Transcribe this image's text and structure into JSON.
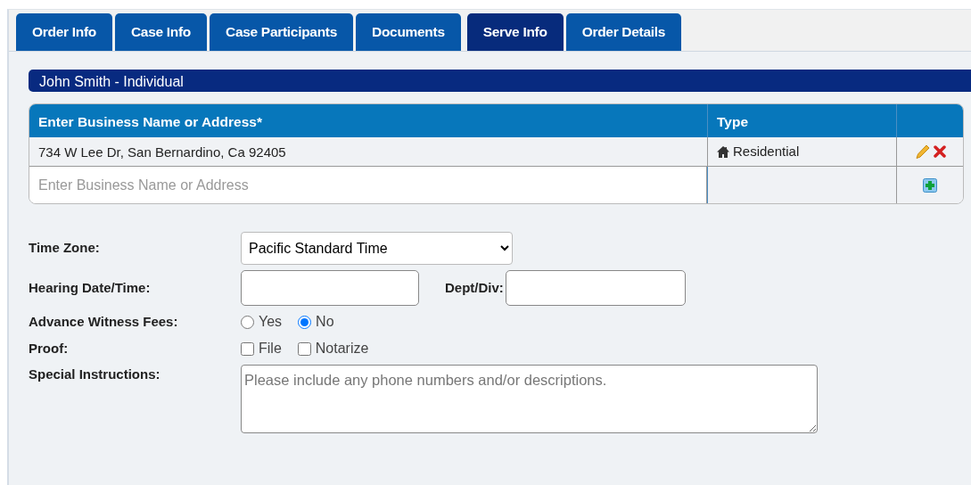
{
  "tabs": [
    {
      "label": "Order Info",
      "selected": false
    },
    {
      "label": "Case Info",
      "selected": false
    },
    {
      "label": "Case Participants",
      "selected": false
    },
    {
      "label": "Documents",
      "selected": false
    },
    {
      "label": "Serve Info",
      "selected": true
    },
    {
      "label": "Order Details",
      "selected": false
    }
  ],
  "party": {
    "title": "John Smith - Individual"
  },
  "table": {
    "columns": [
      "Enter Business Name or Address*",
      "Type"
    ],
    "rows": [
      {
        "address": "734 W Lee Dr, San Bernardino, Ca 92405",
        "type": "Residential"
      }
    ],
    "new_row": {
      "placeholder": "Enter Business Name or Address"
    }
  },
  "form": {
    "time_zone": {
      "label": "Time Zone:",
      "value": "Pacific Standard Time"
    },
    "hearing": {
      "label": "Hearing Date/Time:"
    },
    "dept": {
      "label": "Dept/Div:"
    },
    "witness_fees": {
      "label": "Advance Witness Fees:",
      "options": [
        {
          "label": "Yes",
          "selected": false
        },
        {
          "label": "No",
          "selected": true
        }
      ]
    },
    "proof": {
      "label": "Proof:",
      "options": [
        {
          "label": "File",
          "checked": false
        },
        {
          "label": "Notarize",
          "checked": false
        }
      ]
    },
    "instructions": {
      "label": "Special Instructions:",
      "placeholder": "Please include any phone numbers and/or descriptions."
    }
  }
}
